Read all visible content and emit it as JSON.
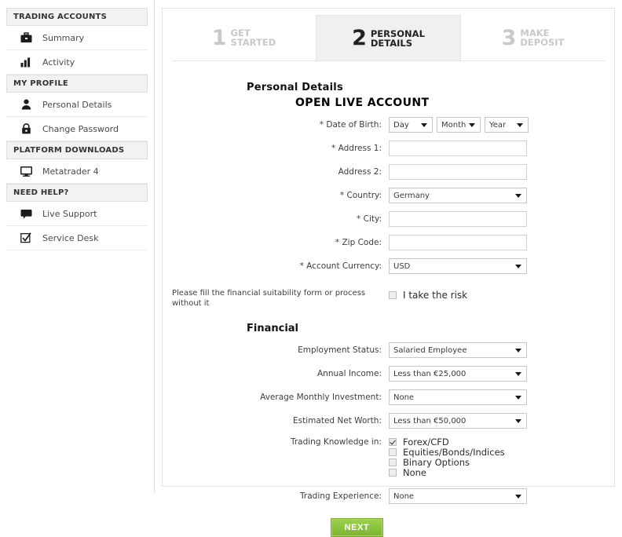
{
  "sidebar": {
    "groups": [
      {
        "header": "TRADING ACCOUNTS",
        "items": [
          {
            "label": "Summary",
            "icon": "briefcase-icon"
          },
          {
            "label": "Activity",
            "icon": "bar-chart-icon"
          }
        ]
      },
      {
        "header": "MY PROFILE",
        "items": [
          {
            "label": "Personal Details",
            "icon": "user-icon"
          },
          {
            "label": "Change Password",
            "icon": "lock-icon"
          }
        ]
      },
      {
        "header": "PLATFORM DOWNLOADS",
        "items": [
          {
            "label": "Metatrader 4",
            "icon": "monitor-icon"
          }
        ]
      },
      {
        "header": "NEED HELP?",
        "items": [
          {
            "label": "Live Support",
            "icon": "chat-bubble-icon"
          },
          {
            "label": "Service Desk",
            "icon": "checked-box-icon"
          }
        ]
      }
    ]
  },
  "steps": [
    {
      "num": "1",
      "line1": "GET",
      "line2": "STARTED",
      "active": false
    },
    {
      "num": "2",
      "line1": "PERSONAL",
      "line2": "DETAILS",
      "active": true
    },
    {
      "num": "3",
      "line1": "MAKE",
      "line2": "DEPOSIT",
      "active": false
    }
  ],
  "form": {
    "title": "Personal Details",
    "subtitle": "OPEN LIVE ACCOUNT",
    "dob": {
      "label": "* Date of Birth:",
      "day": "Day",
      "month": "Month",
      "year": "Year"
    },
    "address1": {
      "label": "* Address 1:",
      "value": "",
      "placeholder": ""
    },
    "address2": {
      "label": "Address 2:",
      "value": "",
      "placeholder": ""
    },
    "country": {
      "label": "* Country:",
      "value": "Germany"
    },
    "city": {
      "label": "* City:",
      "value": "",
      "placeholder": ""
    },
    "zip": {
      "label": "* Zip Code:",
      "value": "",
      "placeholder": ""
    },
    "currency": {
      "label": "* Account Currency:",
      "value": "USD"
    },
    "risk": {
      "note": "Please fill the financial suitability form or process without it",
      "checkbox_label": "I take the risk",
      "checked": false
    },
    "financial_title": "Financial",
    "employment": {
      "label": "Employment Status:",
      "value": "Salaried Employee"
    },
    "annual_income": {
      "label": "Annual Income:",
      "value": "Less than €25,000"
    },
    "monthly_investment": {
      "label": "Average Monthly Investment:",
      "value": "None"
    },
    "net_worth": {
      "label": "Estimated Net Worth:",
      "value": "Less than €50,000"
    },
    "knowledge": {
      "label": "Trading Knowledge in:",
      "options": [
        {
          "label": "Forex/CFD",
          "checked": true
        },
        {
          "label": "Equities/Bonds/Indices",
          "checked": false
        },
        {
          "label": "Binary Options",
          "checked": false
        },
        {
          "label": "None",
          "checked": false
        }
      ]
    },
    "experience": {
      "label": "Trading Experience:",
      "value": "None"
    },
    "next_label": "NEXT"
  },
  "colors": {
    "accent_green": "#8cc63e",
    "active_tab_bg": "#f0f0f0",
    "section_header_bg": "#f2f2f2"
  }
}
